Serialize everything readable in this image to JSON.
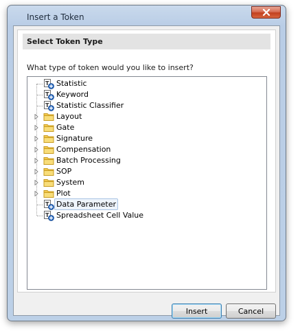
{
  "window": {
    "title": "Insert a Token"
  },
  "section": {
    "header": "Select Token Type",
    "question": "What type of token would you like to insert?"
  },
  "tree": {
    "items": [
      {
        "label": "Statistic",
        "icon": "token-icon",
        "expandable": false
      },
      {
        "label": "Keyword",
        "icon": "token-icon",
        "expandable": false
      },
      {
        "label": "Statistic Classifier",
        "icon": "token-icon",
        "expandable": false
      },
      {
        "label": "Layout",
        "icon": "folder-icon",
        "expandable": true
      },
      {
        "label": "Gate",
        "icon": "folder-icon",
        "expandable": true
      },
      {
        "label": "Signature",
        "icon": "folder-icon",
        "expandable": true
      },
      {
        "label": "Compensation",
        "icon": "folder-icon",
        "expandable": true
      },
      {
        "label": "Batch Processing",
        "icon": "folder-icon",
        "expandable": true
      },
      {
        "label": "SOP",
        "icon": "folder-icon",
        "expandable": true
      },
      {
        "label": "System",
        "icon": "folder-icon",
        "expandable": true
      },
      {
        "label": "Plot",
        "icon": "folder-icon",
        "expandable": true
      },
      {
        "label": "Data Parameter",
        "icon": "token-icon",
        "expandable": false,
        "selected": true
      },
      {
        "label": "Spreadsheet Cell Value",
        "icon": "token-icon",
        "expandable": false
      }
    ]
  },
  "buttons": {
    "insert": "Insert",
    "cancel": "Cancel"
  },
  "colors": {
    "selection_border": "#a7c3e4",
    "folder": "#f3c94f",
    "token_blue": "#2a6bc2"
  }
}
